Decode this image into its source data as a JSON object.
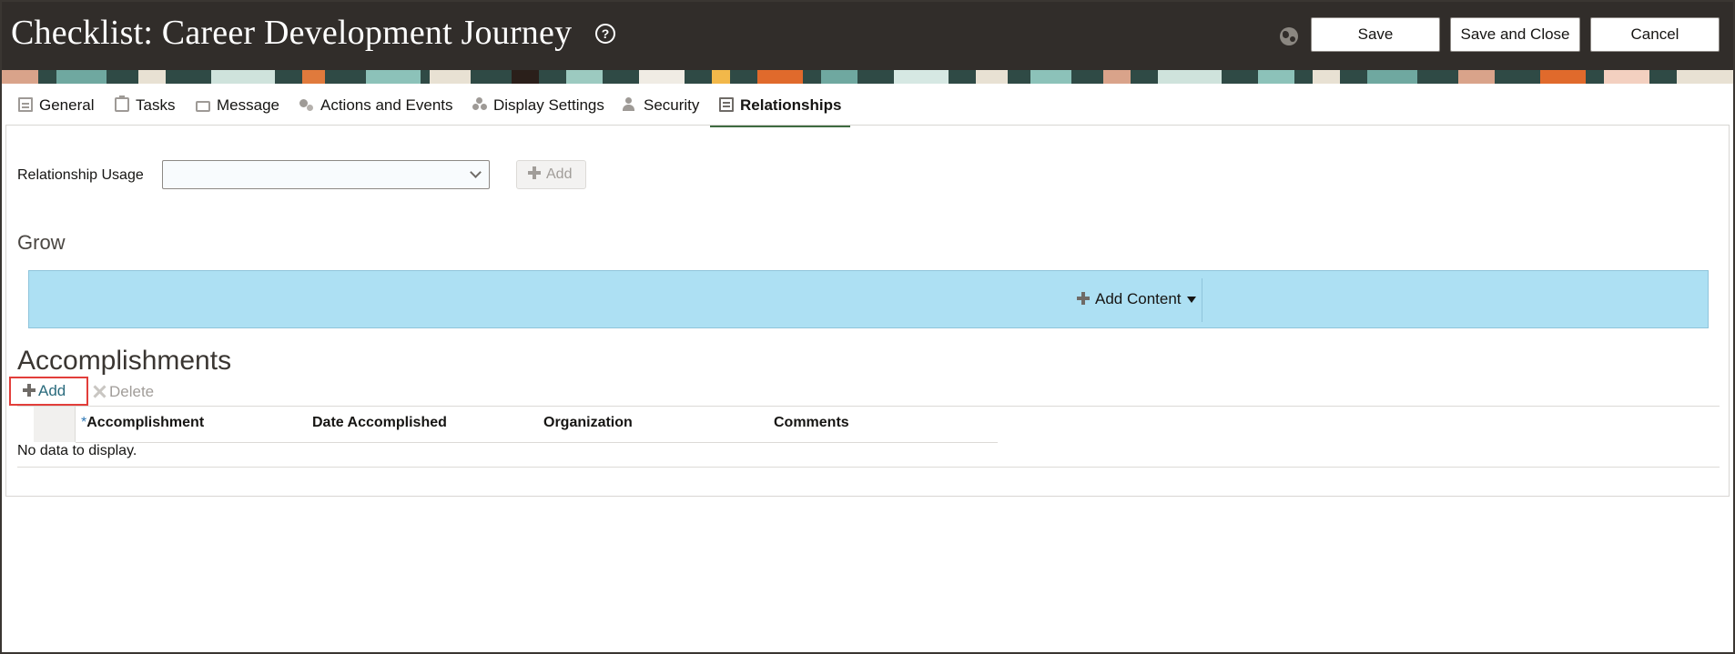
{
  "header": {
    "title": "Checklist: Career Development Journey",
    "save_label": "Save",
    "save_close_label": "Save and Close",
    "cancel_label": "Cancel"
  },
  "tabs": [
    {
      "label": "General",
      "icon": "document-icon"
    },
    {
      "label": "Tasks",
      "icon": "clipboard-icon"
    },
    {
      "label": "Message",
      "icon": "message-icon"
    },
    {
      "label": "Actions and Events",
      "icon": "gears-icon"
    },
    {
      "label": "Display Settings",
      "icon": "dots-icon"
    },
    {
      "label": "Security",
      "icon": "person-lock-icon"
    },
    {
      "label": "Relationships",
      "icon": "relationships-icon",
      "active": true
    }
  ],
  "relationship_usage": {
    "label": "Relationship Usage",
    "value": "",
    "add_label": "Add"
  },
  "grow": {
    "title": "Grow",
    "add_content_label": "Add Content"
  },
  "accomplishments": {
    "title": "Accomplishments",
    "add_label": "Add",
    "delete_label": "Delete",
    "columns": [
      "Accomplishment",
      "Date Accomplished",
      "Organization",
      "Comments"
    ],
    "required_marker": "*",
    "empty_text": "No data to display."
  },
  "colors": {
    "header_bg": "#312d2a",
    "grow_bar_bg": "#ade0f3",
    "active_tab_underline": "#3f6b41",
    "highlight_box": "#e23e3a",
    "link_text": "#2a6b7d"
  }
}
